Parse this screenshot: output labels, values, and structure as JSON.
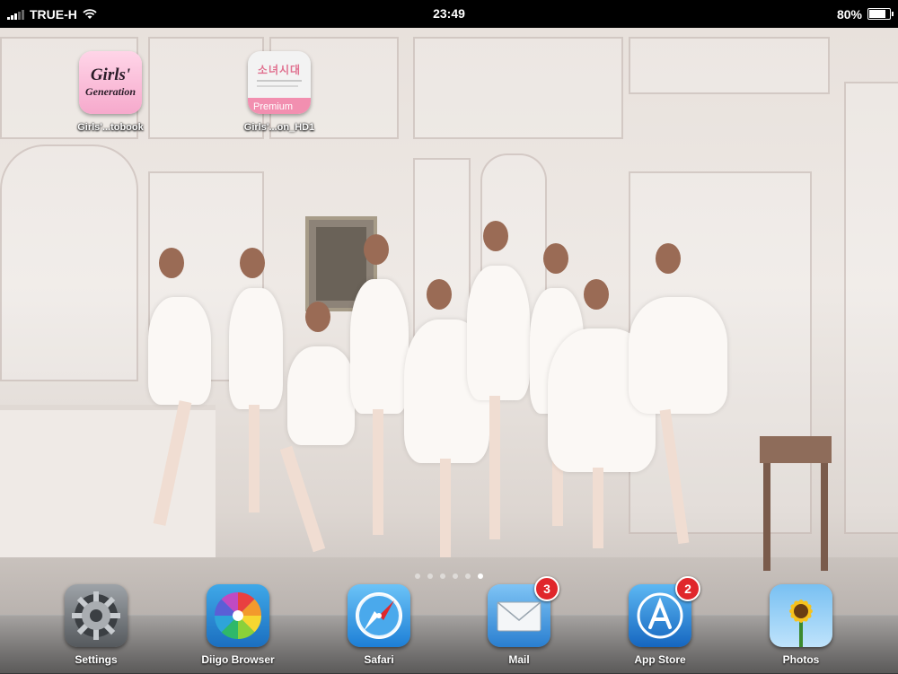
{
  "status_bar": {
    "carrier": "TRUE-H",
    "time": "23:49",
    "battery_percent": "80%",
    "battery_level": 0.8,
    "signal_icon": "signal-bars-icon",
    "wifi_icon": "wifi-icon"
  },
  "home_apps": [
    {
      "label": "Girls'...tobook",
      "icon_title_line1": "Girls'",
      "icon_title_line2": "Generation",
      "icon": "girls-generation-photobook-icon"
    },
    {
      "label": "Girls'...on_HD1",
      "icon_logo_text": "소녀시대",
      "icon_footer_text": "Premium",
      "icon": "girls-generation-hd-icon"
    }
  ],
  "page_indicator": {
    "pages": 6,
    "current": 6
  },
  "dock": [
    {
      "label": "Settings",
      "icon": "settings-gear-icon"
    },
    {
      "label": "Diigo Browser",
      "icon": "diigo-browser-icon"
    },
    {
      "label": "Safari",
      "icon": "safari-compass-icon"
    },
    {
      "label": "Mail",
      "icon": "mail-envelope-icon",
      "badge": "3"
    },
    {
      "label": "App Store",
      "icon": "app-store-icon",
      "badge": "2"
    },
    {
      "label": "Photos",
      "icon": "photos-sunflower-icon"
    }
  ],
  "colors": {
    "badge_red": "#e0262b",
    "status_bar_bg": "#000000",
    "label_text": "#ffffff"
  }
}
